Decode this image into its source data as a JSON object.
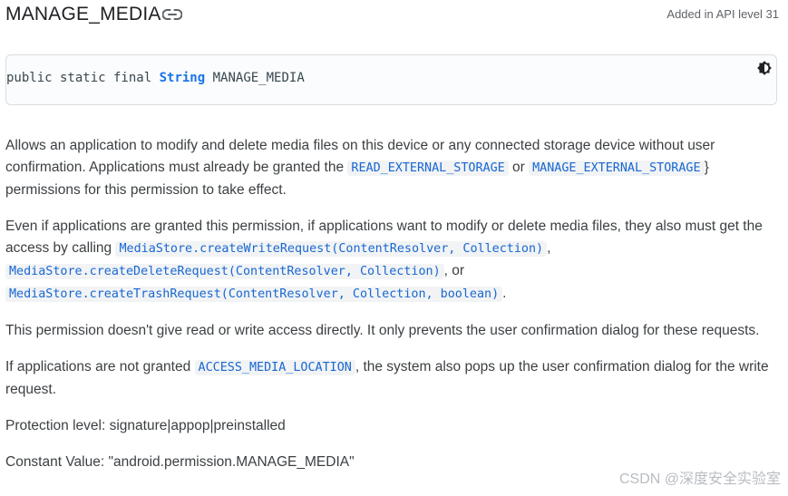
{
  "header": {
    "title": "MANAGE_MEDIA",
    "api_level": "Added in API level 31",
    "link_icon": "link-icon"
  },
  "declaration": {
    "modifiers": "public static final",
    "type": "String",
    "name": "MANAGE_MEDIA",
    "theme_icon": "theme-toggle-icon"
  },
  "description": {
    "p1": {
      "text1": "Allows an application to modify and delete media files on this device or any connected storage device without user confirmation. Applications must already be granted the",
      "code1": "READ_EXTERNAL_STORAGE",
      "text2": "or",
      "code2": "MANAGE_EXTERNAL_STORAGE",
      "text3": "} permissions for this permission to take effect."
    },
    "p2": {
      "text1": "Even if applications are granted this permission, if applications want to modify or delete media files, they also must get the access by calling",
      "code1": "MediaStore.createWriteRequest(ContentResolver, Collection)",
      "text2": ",",
      "code2": "MediaStore.createDeleteRequest(ContentResolver, Collection)",
      "text3": ", or",
      "code3": "MediaStore.createTrashRequest(ContentResolver, Collection, boolean)",
      "text4": "."
    },
    "p3": "This permission doesn't give read or write access directly. It only prevents the user confirmation dialog for these requests.",
    "p4": {
      "text1": "If applications are not granted",
      "code1": "ACCESS_MEDIA_LOCATION",
      "text2": ", the system also pops up the user confirmation dialog for the write request."
    },
    "protection_level": "Protection level: signature|appop|preinstalled",
    "constant_value": "Constant Value: \"android.permission.MANAGE_MEDIA\""
  },
  "watermark": "CSDN @深度安全实验室",
  "colors": {
    "code_link": "#1967d2",
    "code_bg": "#f1f3f4",
    "type_keyword": "#1a73e8",
    "body_text": "#3c4043"
  }
}
